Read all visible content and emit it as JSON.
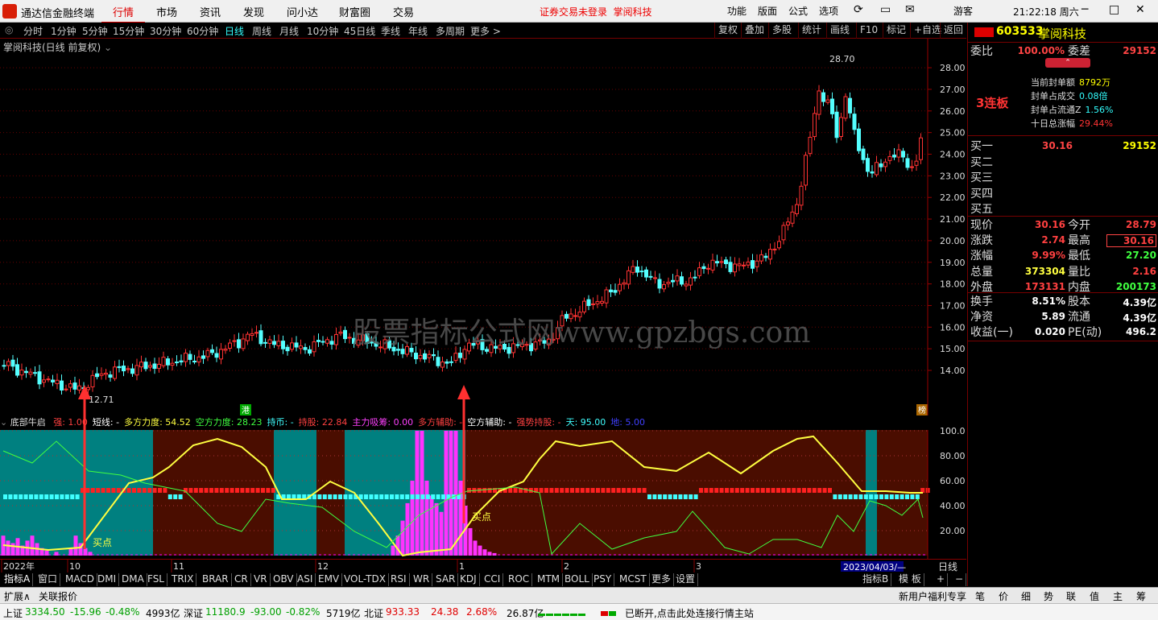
{
  "app": {
    "title": "通达信金融终端",
    "login_status": "证券交易未登录",
    "login_stock": "掌阅科技",
    "clock": "21:22:18 周六",
    "guest": "游客"
  },
  "menu": [
    "行情",
    "市场",
    "资讯",
    "发现",
    "问小达",
    "财富圈",
    "交易"
  ],
  "toolbar": [
    "功能",
    "版面",
    "公式",
    "选项"
  ],
  "periods": [
    "分时",
    "1分钟",
    "5分钟",
    "15分钟",
    "30分钟",
    "60分钟",
    "日线",
    "周线",
    "月线",
    "10分钟",
    "45日线",
    "季线",
    "年线",
    "多周期",
    "更多 >"
  ],
  "active_period": "日线",
  "right_tools": [
    "复权",
    "叠加",
    "多股",
    "统计",
    "画线",
    "F10",
    "标记",
    "+自选",
    "返回"
  ],
  "chart": {
    "stock_label": "掌阅科技(日线 前复权)",
    "high_label": "28.70",
    "low_label": "12.71",
    "watermark": "股票指标公式网www.gpzbgs.com",
    "gang_tag": "港",
    "bang_tag": "榜",
    "price_ticks": [
      "28.00",
      "27.00",
      "26.00",
      "25.00",
      "24.00",
      "23.00",
      "22.00",
      "21.00",
      "20.00",
      "19.00",
      "18.00",
      "17.00",
      "16.00",
      "15.00",
      "14.00"
    ],
    "ind_ticks": [
      "100.0",
      "80.00",
      "60.00",
      "40.00",
      "20.00"
    ],
    "buy_label": "买点",
    "time_labels": [
      "2022年",
      "10",
      "11",
      "12",
      "1",
      "2",
      "3"
    ],
    "date_box": "2023/04/03/—",
    "period_tag": "日线"
  },
  "indicator": {
    "name": "底部牛启",
    "items": [
      {
        "label": "强: 1.00",
        "color": "#ff4040"
      },
      {
        "label": "短线: -",
        "color": "#ffffff"
      },
      {
        "label": "多方力度: 54.52",
        "color": "#ffff40"
      },
      {
        "label": "空方力度: 28.23",
        "color": "#40ff40"
      },
      {
        "label": "持币: -",
        "color": "#40ffff"
      },
      {
        "label": "持股: 22.84",
        "color": "#ff4040"
      },
      {
        "label": "主力吸筹: 0.00",
        "color": "#ff40ff"
      },
      {
        "label": "多方辅助: -",
        "color": "#ff4040"
      },
      {
        "label": "空方辅助: -",
        "color": "#ffffff"
      },
      {
        "label": "强势持股: -",
        "color": "#ff4040"
      },
      {
        "label": "天: 95.00",
        "color": "#40ffff"
      },
      {
        "label": "地: 5.00",
        "color": "#4040ff"
      }
    ]
  },
  "tabs": [
    "指标A",
    "窗口",
    "MACD",
    "DMI",
    "DMA",
    "FSL",
    "TRIX",
    "BRAR",
    "CR",
    "VR",
    "OBV",
    "ASI",
    "EMV",
    "VOL-TDX",
    "RSI",
    "WR",
    "SAR",
    "KDJ",
    "CCI",
    "ROC",
    "MTM",
    "BOLL",
    "PSY",
    "MCST",
    "更多",
    "设置"
  ],
  "tabs_right": [
    "指标B",
    "模 板",
    "+",
    "−"
  ],
  "status_left": [
    "扩展∧",
    "关联报价"
  ],
  "status_right": [
    "新用户福利专享",
    "笔",
    "价",
    "细",
    "势",
    "联",
    "值",
    "主",
    "筹"
  ],
  "quote": {
    "code": "603533",
    "name": "掌阅科技",
    "weibi_label": "委比",
    "weibi": "100.00%",
    "weicha_label": "委差",
    "weicha": "29152",
    "lianban": "3连板",
    "seal": [
      {
        "k": "当前封单额",
        "v": "8792万"
      },
      {
        "k": "封单占成交",
        "v": "0.08倍"
      },
      {
        "k": "封单占流通Z",
        "v": "1.56%"
      },
      {
        "k": "十日总涨幅",
        "v": "29.44%"
      }
    ],
    "bids": [
      {
        "k": "买一",
        "p": "30.16",
        "v": "29152"
      },
      {
        "k": "买二",
        "p": "",
        "v": ""
      },
      {
        "k": "买三",
        "p": "",
        "v": ""
      },
      {
        "k": "买四",
        "p": "",
        "v": ""
      },
      {
        "k": "买五",
        "p": "",
        "v": ""
      }
    ],
    "stats": [
      {
        "k1": "现价",
        "v1": "30.16",
        "c1": "#ff4040",
        "k2": "今开",
        "v2": "28.79",
        "c2": "#ff4040"
      },
      {
        "k1": "涨跌",
        "v1": "2.74",
        "c1": "#ff4040",
        "k2": "最高",
        "v2": "30.16",
        "c2": "#ff4040"
      },
      {
        "k1": "涨幅",
        "v1": "9.99%",
        "c1": "#ff4040",
        "k2": "最低",
        "v2": "27.20",
        "c2": "#40ff40"
      },
      {
        "k1": "总量",
        "v1": "373304",
        "c1": "#ffff40",
        "k2": "量比",
        "v2": "2.16",
        "c2": "#ff4040"
      },
      {
        "k1": "外盘",
        "v1": "173131",
        "c1": "#ff4040",
        "k2": "内盘",
        "v2": "200173",
        "c2": "#40ff40"
      },
      {
        "k1": "换手",
        "v1": "8.51%",
        "c1": "#ffffff",
        "k2": "股本",
        "v2": "4.39亿",
        "c2": "#ffffff"
      },
      {
        "k1": "净资",
        "v1": "5.89",
        "c1": "#ffffff",
        "k2": "流通",
        "v2": "4.39亿",
        "c2": "#ffffff"
      },
      {
        "k1": "收益(一)",
        "v1": "0.020",
        "c1": "#ffffff",
        "k2": "PE(动)",
        "v2": "496.2",
        "c2": "#ffffff"
      }
    ]
  },
  "index_bar": [
    {
      "name": "上证",
      "val": "3334.50",
      "chg": "-15.96",
      "pct": "-0.48%",
      "amt": "4993亿",
      "color": "#00a000"
    },
    {
      "name": "深证",
      "val": "11180.9",
      "chg": "-93.00",
      "pct": "-0.82%",
      "amt": "5719亿",
      "color": "#00a000"
    },
    {
      "name": "北证",
      "val": "933.33",
      "chg": "24.38",
      "pct": "2.68%",
      "amt": "26.87亿",
      "color": "#e00000"
    }
  ],
  "net_status": "已断开,点击此处连接行情主站"
}
